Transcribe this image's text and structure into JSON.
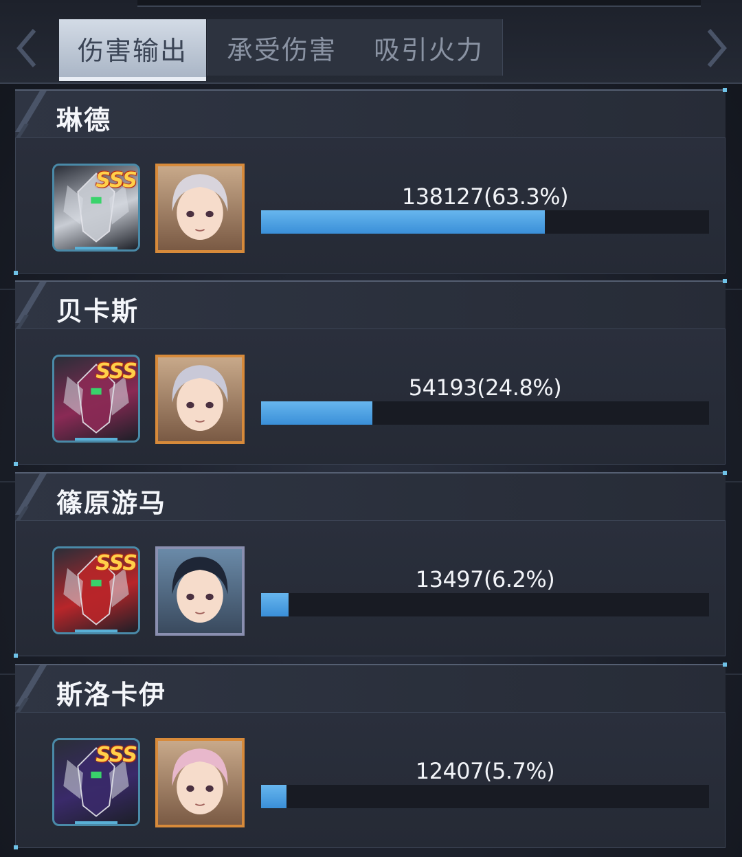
{
  "tabs": [
    {
      "label": "伤害输出",
      "active": true
    },
    {
      "label": "承受伤害",
      "active": false
    },
    {
      "label": "吸引火力",
      "active": false
    }
  ],
  "nav": {
    "prev_icon": "chevron-left-icon",
    "next_icon": "chevron-right-icon"
  },
  "grade_label": "SSS",
  "colors": {
    "bar_fill": "#4ea3e6",
    "bar_track": "#181b23",
    "accent": "#6fc3e8",
    "grade": "#ffd04a"
  },
  "rows": [
    {
      "name": "琳德",
      "value_text": "138127(63.3%)",
      "percent": 63.3,
      "mecha_color": "#c9cdd4",
      "pilot_frame": "gold",
      "pilot_hair": "#d8d4dc"
    },
    {
      "name": "贝卡斯",
      "value_text": "54193(24.8%)",
      "percent": 24.8,
      "mecha_color": "#8a2a55",
      "pilot_frame": "gold",
      "pilot_hair": "#c9c9d8"
    },
    {
      "name": "篠原游马",
      "value_text": "13497(6.2%)",
      "percent": 6.2,
      "mecha_color": "#b8262a",
      "pilot_frame": "silver",
      "pilot_hair": "#1e2636"
    },
    {
      "name": "斯洛卡伊",
      "value_text": "12407(5.7%)",
      "percent": 5.7,
      "mecha_color": "#3a2a6a",
      "pilot_frame": "gold",
      "pilot_hair": "#e8b8cc"
    }
  ]
}
